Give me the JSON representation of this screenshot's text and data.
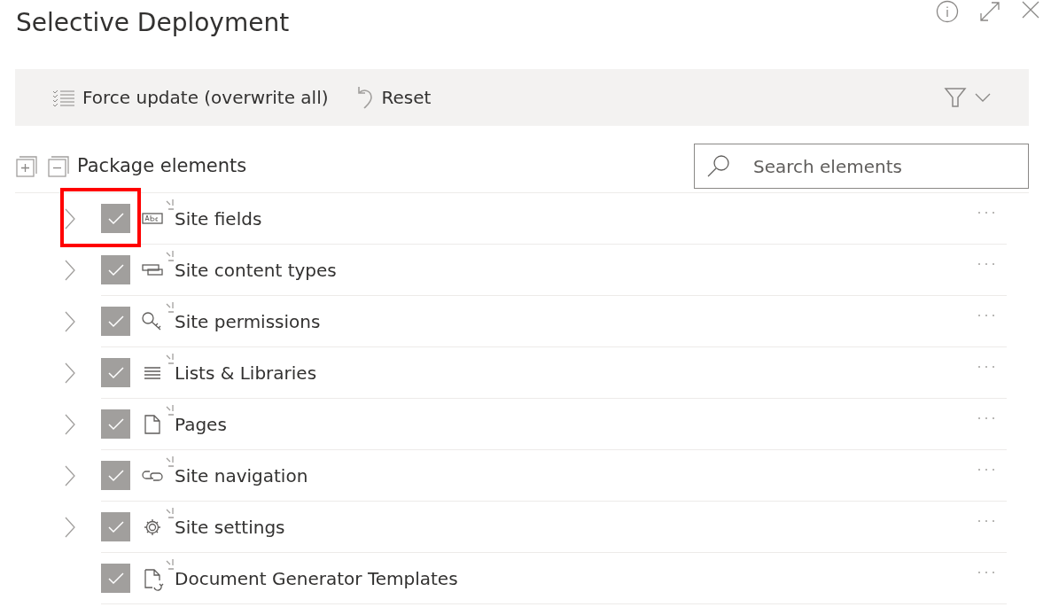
{
  "panel": {
    "title": "Selective Deployment"
  },
  "toolbar": {
    "actions": [
      {
        "kind": "force",
        "label": "Force update (overwrite all)"
      },
      {
        "kind": "reset",
        "label": "Reset"
      }
    ]
  },
  "tree": {
    "header": "Package elements",
    "search": {
      "placeholder": "Search elements"
    },
    "items": [
      {
        "kind": "fields",
        "label": "Site fields",
        "expandable": true,
        "checked": true,
        "is_new": true,
        "highlighted": true
      },
      {
        "kind": "content-types",
        "label": "Site content types",
        "expandable": true,
        "checked": true,
        "is_new": true,
        "highlighted": false
      },
      {
        "kind": "permissions",
        "label": "Site permissions",
        "expandable": true,
        "checked": true,
        "is_new": true,
        "highlighted": false
      },
      {
        "kind": "lists",
        "label": "Lists & Libraries",
        "expandable": true,
        "checked": true,
        "is_new": true,
        "highlighted": false
      },
      {
        "kind": "pages",
        "label": "Pages",
        "expandable": true,
        "checked": true,
        "is_new": true,
        "highlighted": false
      },
      {
        "kind": "navigation",
        "label": "Site navigation",
        "expandable": true,
        "checked": true,
        "is_new": true,
        "highlighted": false
      },
      {
        "kind": "settings",
        "label": "Site settings",
        "expandable": true,
        "checked": true,
        "is_new": true,
        "highlighted": false
      },
      {
        "kind": "document-template",
        "label": "Document Generator Templates",
        "expandable": false,
        "checked": true,
        "is_new": true,
        "highlighted": false
      }
    ]
  }
}
